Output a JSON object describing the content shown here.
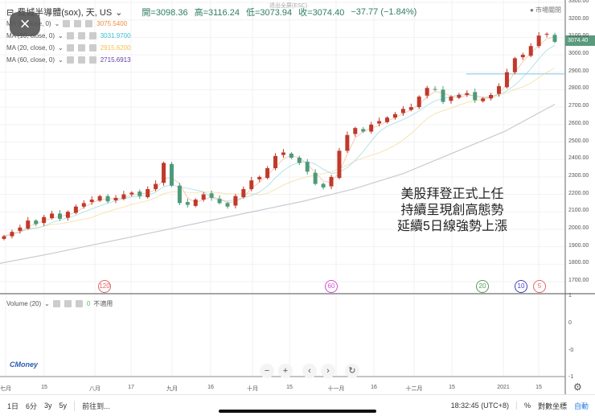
{
  "header": {
    "symbol": "費城半導體(sox), 天, US",
    "open": "開=3098.36",
    "high": "高=3116.24",
    "low": "低=3073.94",
    "close": "收=3074.40",
    "change": "−37.77 (−1.84%)",
    "market_status": "市場關閉",
    "esc_hint": "退出全屏(ESC)"
  },
  "indicators": [
    {
      "label": "MA (5, close, 0)",
      "value": "3075.5400",
      "color": "#f08a3c"
    },
    {
      "label": "MA (10, close, 0)",
      "value": "3031.9700",
      "color": "#3fc1d0"
    },
    {
      "label": "MA (20, close, 0)",
      "value": "2915.6200",
      "color": "#f2c14e"
    },
    {
      "label": "MA (60, close, 0)",
      "value": "2715.6913",
      "color": "#5b3fa8"
    }
  ],
  "close_icon": "×",
  "annotation": [
    "美股拜登正式上任",
    "持續呈現創高態勢",
    "延續5日線強勢上漲"
  ],
  "price_tag": "3074.40",
  "ma_badges": [
    {
      "label": "120",
      "color": "#e06666"
    },
    {
      "label": "60",
      "color": "#d04fd0"
    },
    {
      "label": "20",
      "color": "#5a9a5a"
    },
    {
      "label": "10",
      "color": "#4040c0"
    },
    {
      "label": "5",
      "color": "#e06666"
    }
  ],
  "volume": {
    "label": "Volume (20)",
    "value": "0",
    "na": "不適用",
    "axis": [
      "1",
      "0",
      "-0",
      "-1"
    ]
  },
  "logo": "CMoney",
  "nav": {
    "zoom_out": "−",
    "zoom_in": "+",
    "prev": "‹",
    "next": "›",
    "reset": "↻"
  },
  "bottom": {
    "ranges": [
      "1日",
      "6分",
      "3y",
      "5y"
    ],
    "goto": "前往到...",
    "time": "18:32:45 (UTC+8)",
    "percent": "%",
    "log": "對數坐標",
    "auto": "自動"
  },
  "chart_data": {
    "type": "candlestick",
    "x_ticks": [
      "七月",
      "15",
      "八月",
      "17",
      "九月",
      "16",
      "十月",
      "15",
      "十一月",
      "16",
      "十二月",
      "15",
      "2021",
      "15"
    ],
    "y_ticks": [
      "3300.00",
      "3200.00",
      "3100.00",
      "3000.00",
      "2900.00",
      "2800.00",
      "2700.00",
      "2600.00",
      "2500.00",
      "2400.00",
      "2300.00",
      "2200.00",
      "2100.00",
      "2000.00",
      "1900.00",
      "1800.00",
      "1700.00"
    ],
    "ylim": [
      1700,
      3300
    ],
    "horizontal_line": 2890,
    "closes": [
      1960,
      1985,
      2010,
      2050,
      2030,
      2070,
      2090,
      2060,
      2100,
      2130,
      2150,
      2170,
      2190,
      2160,
      2180,
      2200,
      2210,
      2190,
      2230,
      2260,
      2380,
      2250,
      2150,
      2140,
      2170,
      2200,
      2180,
      2150,
      2130,
      2190,
      2230,
      2280,
      2300,
      2350,
      2420,
      2440,
      2410,
      2380,
      2330,
      2260,
      2240,
      2300,
      2450,
      2540,
      2580,
      2560,
      2600,
      2620,
      2640,
      2660,
      2690,
      2700,
      2760,
      2810,
      2800,
      2730,
      2760,
      2770,
      2780,
      2740,
      2750,
      2770,
      2820,
      2900,
      2980,
      3000,
      3050,
      3110,
      3120,
      3074
    ],
    "long_ma": [
      1805,
      1860,
      1920,
      1980,
      2040,
      2100,
      2160,
      2230,
      2320,
      2440,
      2560,
      2716
    ],
    "up_color": "#c0392b",
    "down_color": "#4d9a7a"
  }
}
